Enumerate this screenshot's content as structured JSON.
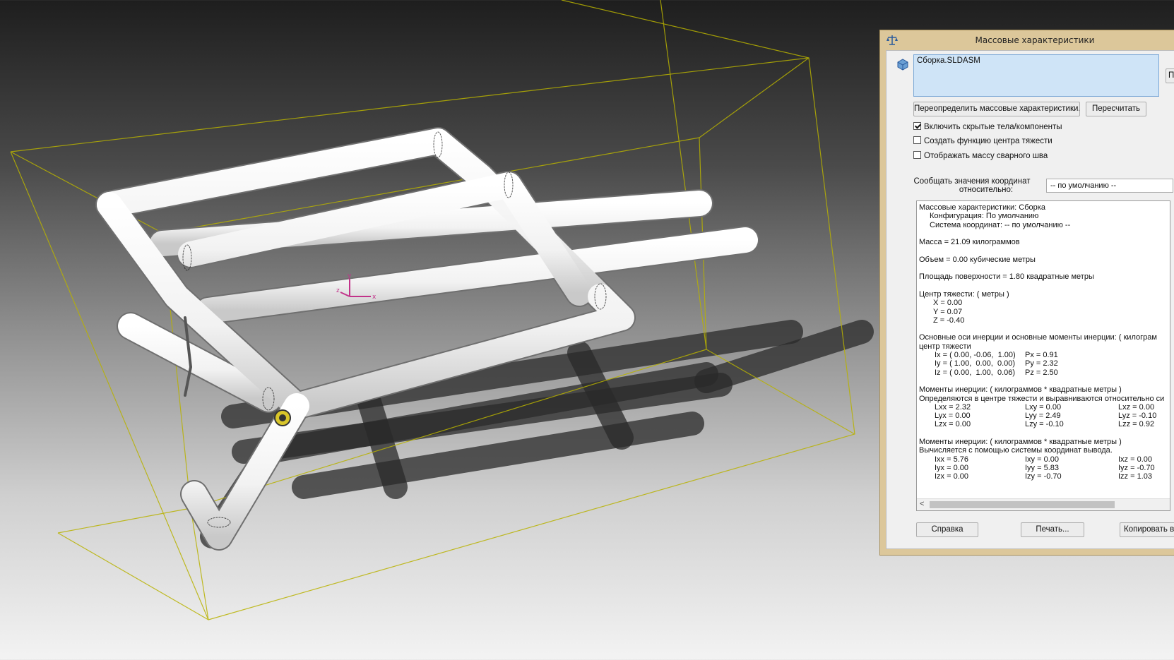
{
  "dialog": {
    "title": "Массовые характеристики",
    "selection": "Сборка.SLDASM",
    "param_button_partial": "Па",
    "override_button": "Переопределить массовые характеристики...",
    "recalc_button": "Пересчитать",
    "checkboxes": [
      {
        "label": "Включить скрытые тела/компоненты",
        "checked": true
      },
      {
        "label": "Создать функцию центра тяжести",
        "checked": false
      },
      {
        "label": "Отображать массу сварного шва",
        "checked": false
      }
    ],
    "coord_label_line1": "Сообщать значения координат",
    "coord_label_line2": "относительно:",
    "coord_select_value": "-- по умолчанию --",
    "results": {
      "l1": "Массовые характеристики: Сборка",
      "l2": "Конфигурация: По умолчанию",
      "l3": "Система координат: -- по умолчанию --",
      "mass": "Масса = 21.09 килограммов",
      "volume": "Объем = 0.00 кубические метры",
      "area": "Площадь поверхности = 1.80 квадратные метры",
      "cog_title": "Центр тяжести: ( метры )",
      "cx": "X = 0.00",
      "cy": "Y = 0.07",
      "cz": "Z = -0.40",
      "axes_title": "Основные оси инерции и основные моменты инерции: ( килограм",
      "axes_title2": "центр тяжести",
      "ix": "Ix = ( 0.00, -0.06,  1.00)",
      "iy": "Iy = ( 1.00,  0.00,  0.00)",
      "iz": "Iz = ( 0.00,  1.00,  0.06)",
      "px": "Px = 0.91",
      "py": "Py = 2.32",
      "pz": "Pz = 2.50",
      "mom1_title": "Моменты инерции: ( килограммов * квадратные метры )",
      "mom1_sub": "Определяются в центре тяжести и выравниваются относительно си",
      "lxx": "Lxx = 2.32",
      "lxy": "Lxy = 0.00",
      "lxz": "Lxz = 0.00",
      "lyx": "Lyx = 0.00",
      "lyy": "Lyy = 2.49",
      "lyz": "Lyz = -0.10",
      "lzx": "Lzx = 0.00",
      "lzy": "Lzy = -0.10",
      "lzz": "Lzz = 0.92",
      "mom2_title": "Моменты инерции: ( килограммов * квадратные метры )",
      "mom2_sub": "Вычисляется с помощью системы координат вывода.",
      "ixx": "Ixx = 5.76",
      "ixy": "Ixy = 0.00",
      "ixz": "Ixz = 0.00",
      "iyx": "Iyx = 0.00",
      "iyy": "Iyy = 5.83",
      "iyz": "Iyz = -0.70",
      "izx": "Izx = 0.00",
      "izy": "Izy = -0.70",
      "izz": "Izz = 1.03"
    },
    "scroll_left": "<",
    "help_button": "Справка",
    "print_button": "Печать...",
    "copy_button": "Копировать в"
  },
  "triad": {
    "x": "x",
    "y": "y",
    "z": "z"
  },
  "colors": {
    "bbox": "#b8b200",
    "tube": "#f4f4f4",
    "selection": "#cfe4f7",
    "dialog_frame": "#dcc79a"
  }
}
